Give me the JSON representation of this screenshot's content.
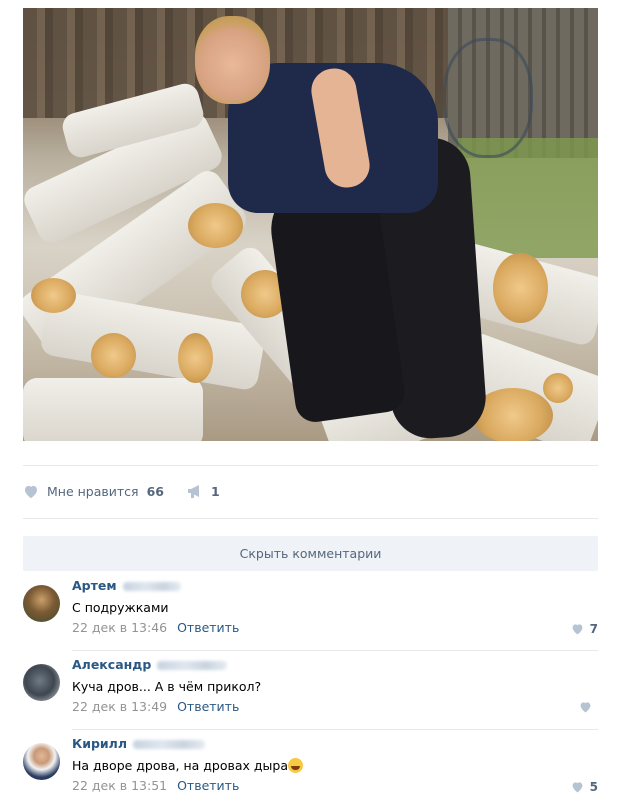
{
  "post": {
    "likes_label": "Мне нравится",
    "likes_count": "66",
    "shares_count": "1"
  },
  "hide_comments_label": "Скрыть комментарии",
  "comments": [
    {
      "author": "Артем",
      "text": "С подружками",
      "date": "22 дек в 13:46",
      "reply": "Ответить",
      "likes": "7"
    },
    {
      "author": "Александр",
      "text": "Куча дров... А в чём прикол?",
      "date": "22 дек в 13:49",
      "reply": "Ответить",
      "likes": ""
    },
    {
      "author": "Кирилл",
      "text": "На дворе дрова, на дровах дыра",
      "date": "22 дек в 13:51",
      "reply": "Ответить",
      "likes": "5"
    }
  ],
  "colors": {
    "link": "#2a5885",
    "muted": "#55677d",
    "meta": "#939393",
    "button_bg": "#eff2f6"
  },
  "icons": {
    "like": "heart-icon",
    "share": "megaphone-icon",
    "emoji": "laughing-emoji-icon"
  }
}
